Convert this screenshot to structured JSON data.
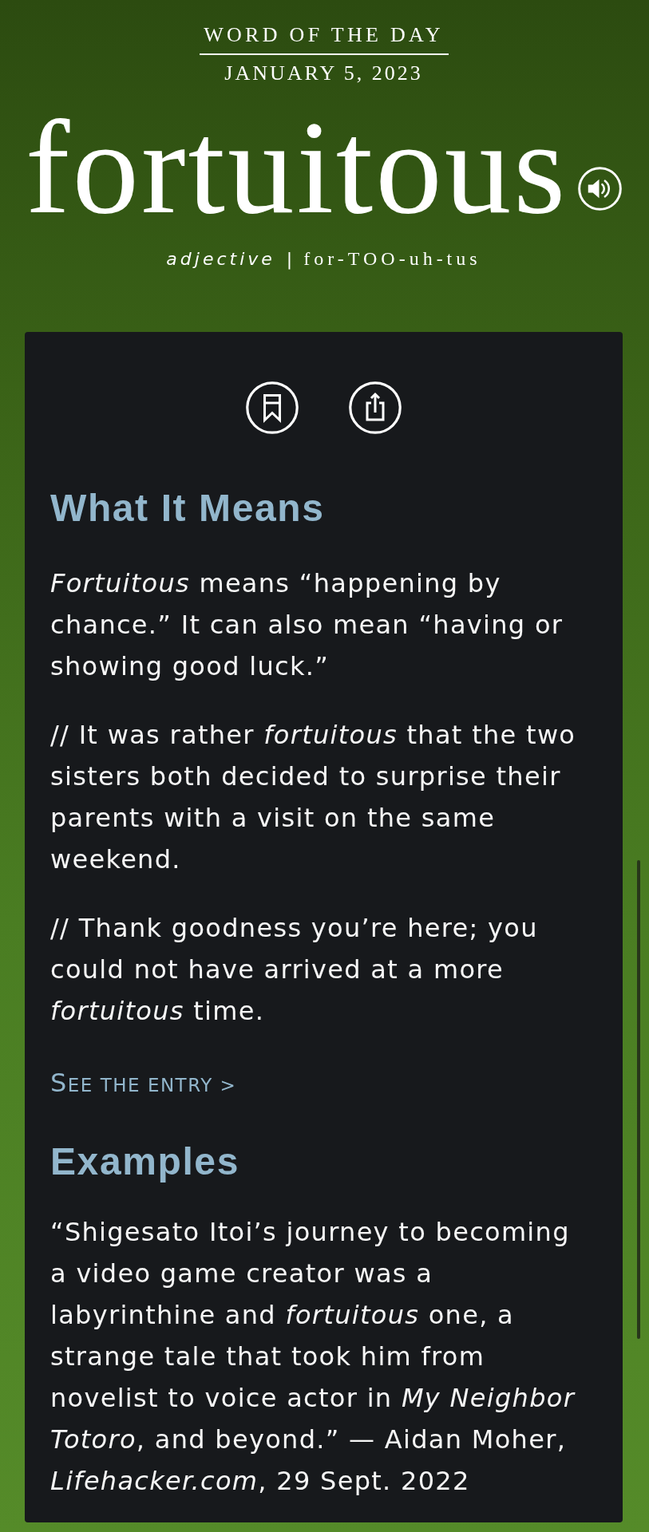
{
  "header": {
    "eyebrow": "WORD OF THE DAY",
    "date": "JANUARY 5, 2023",
    "word": "fortuitous",
    "part_of_speech": "adjective",
    "separator": "|",
    "pronunciation": "for-TOO-uh-tus"
  },
  "sections": [
    {
      "heading": "What It Means",
      "paragraphs": [
        "*Fortuitous* means “happening by chance.” It can also mean “having or showing good luck.”",
        "// It was rather *fortuitous* that the two sisters both decided to surprise their parents with a visit on the same weekend.",
        "// Thank goodness you’re here; you could not have arrived at a more *fortuitous* time."
      ],
      "link": "SEE THE ENTRY >"
    },
    {
      "heading": "Examples",
      "paragraphs": [
        "“Shigesato Itoi’s journey to becoming a video game creator was a labyrinthine and *fortuitous* one, a strange tale that took him from novelist to voice actor in *My Neighbor Totoro*, and beyond.” — Aidan Moher, *Lifehacker.com*, 29 Sept. 2022"
      ]
    }
  ]
}
